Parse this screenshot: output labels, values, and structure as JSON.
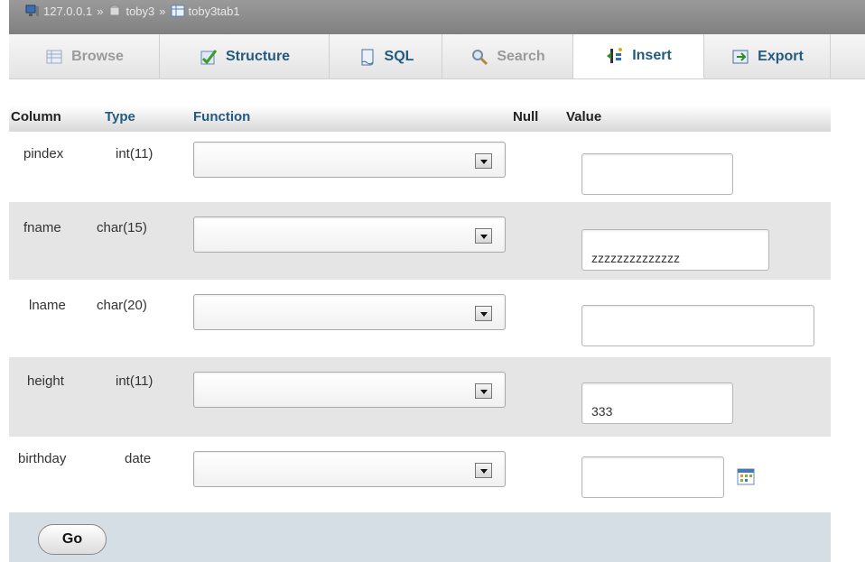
{
  "breadcrumb": {
    "server": "127.0.0.1",
    "separator": "»",
    "database": "toby3",
    "table": "toby3tab1"
  },
  "tabs": [
    {
      "label": "Browse",
      "icon": "browse-icon",
      "state": "disabled"
    },
    {
      "label": "Structure",
      "icon": "structure-icon",
      "state": "normal"
    },
    {
      "label": "SQL",
      "icon": "sql-icon",
      "state": "normal"
    },
    {
      "label": "Search",
      "icon": "search-icon",
      "state": "disabled"
    },
    {
      "label": "Insert",
      "icon": "insert-icon",
      "state": "active"
    },
    {
      "label": "Export",
      "icon": "export-icon",
      "state": "normal"
    }
  ],
  "table": {
    "headers": {
      "column": "Column",
      "type": "Type",
      "function": "Function",
      "null": "Null",
      "value": "Value"
    },
    "rows": [
      {
        "column": "pindex",
        "type": "int(11)",
        "function": "",
        "value": ""
      },
      {
        "column": "fname",
        "type": "char(15)",
        "function": "",
        "value": "zzzzzzzzzzzzzz"
      },
      {
        "column": "lname",
        "type": "char(20)",
        "function": "",
        "value": ""
      },
      {
        "column": "height",
        "type": "int(11)",
        "function": "",
        "value": "333"
      },
      {
        "column": "birthday",
        "type": "date",
        "function": "",
        "value": ""
      }
    ]
  },
  "footer": {
    "go_label": "Go"
  },
  "colors": {
    "link": "#235a81",
    "row_alt": "#e5e5e5",
    "footer_bg": "#d5dde5",
    "breadcrumb_bg": "#8c8c8c"
  }
}
